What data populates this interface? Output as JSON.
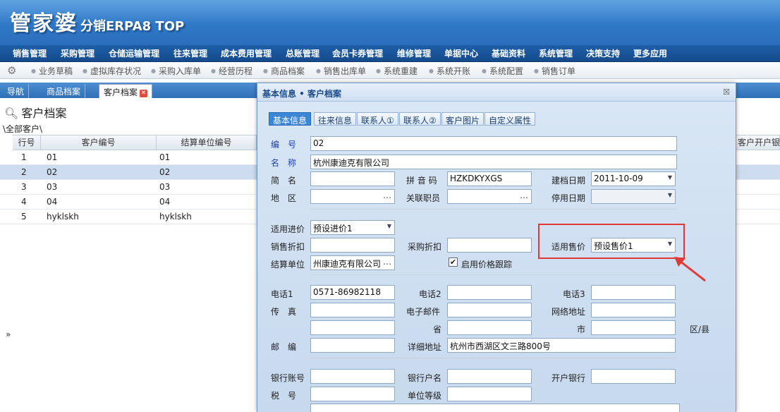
{
  "header": {
    "logo_main": "管家婆",
    "logo_sub": "分销ERPA8 TOP"
  },
  "menu": [
    "销售管理",
    "采购管理",
    "仓储运输管理",
    "往来管理",
    "成本费用管理",
    "总账管理",
    "会员卡券管理",
    "维修管理",
    "单据中心",
    "基础资料",
    "系统管理",
    "决策支持",
    "更多应用"
  ],
  "quickbar": [
    "业务草稿",
    "虚拟库存状况",
    "采购入库单",
    "经营历程",
    "商品档案",
    "销售出库单",
    "系统重建",
    "系统开账",
    "系统配置",
    "销售订单"
  ],
  "tabs": [
    "导航",
    "商品档案",
    "客户档案"
  ],
  "page": {
    "title": "客户档案",
    "breadcrumb": "\\全部客户\\"
  },
  "grid": {
    "headers": [
      "行号",
      "客户编号",
      "结算单位编号",
      "客户开户银"
    ],
    "rows": [
      {
        "no": "1",
        "code": "01",
        "settle": "01"
      },
      {
        "no": "2",
        "code": "02",
        "settle": "02"
      },
      {
        "no": "3",
        "code": "03",
        "settle": "03"
      },
      {
        "no": "4",
        "code": "04",
        "settle": "04"
      },
      {
        "no": "5",
        "code": "hyklskh",
        "settle": "hyklskh"
      }
    ],
    "selected_row": 1
  },
  "expander": "»",
  "dialog": {
    "title": "基本信息 • 客户档案",
    "close": "☒",
    "tabs": [
      "基本信息",
      "往来信息",
      "联系人①",
      "联系人②",
      "客户图片",
      "自定义属性"
    ],
    "labels": {
      "code": "编　号",
      "name": "名　称",
      "short": "简　名",
      "pinyin": "拼 音 码",
      "created": "建档日期",
      "region": "地　区",
      "staff": "关联职员",
      "disabled": "停用日期",
      "buy_price": "适用进价",
      "sale_disc": "销售折扣",
      "buy_disc": "采购折扣",
      "sale_price": "适用售价",
      "settle": "结算单位",
      "price_track": "启用价格跟踪",
      "phone1": "电话1",
      "phone2": "电话2",
      "phone3": "电话3",
      "fax": "传　真",
      "email": "电子邮件",
      "website": "网络地址",
      "province": "省",
      "city": "市",
      "district": "区/县",
      "zip": "邮　编",
      "address": "详细地址",
      "bank_acct": "银行账号",
      "bank_name": "银行户名",
      "bank": "开户银行",
      "tax": "税　号",
      "unit_level": "单位等级"
    },
    "values": {
      "code": "02",
      "name": "杭州康迪克有限公司",
      "pinyin": "HZKDKYXGS",
      "created": "2011-10-09",
      "buy_price": "预设进价1",
      "sale_price": "预设售价1",
      "settle": "州康迪克有限公司",
      "phone1": "0571-86982118",
      "address": "杭州市西湖区文三路800号"
    },
    "price_track_checked": true
  },
  "colors": {
    "highlight": "#e03a37",
    "menubar": "#1d5ea8",
    "active_tab": "#3d86d6"
  }
}
